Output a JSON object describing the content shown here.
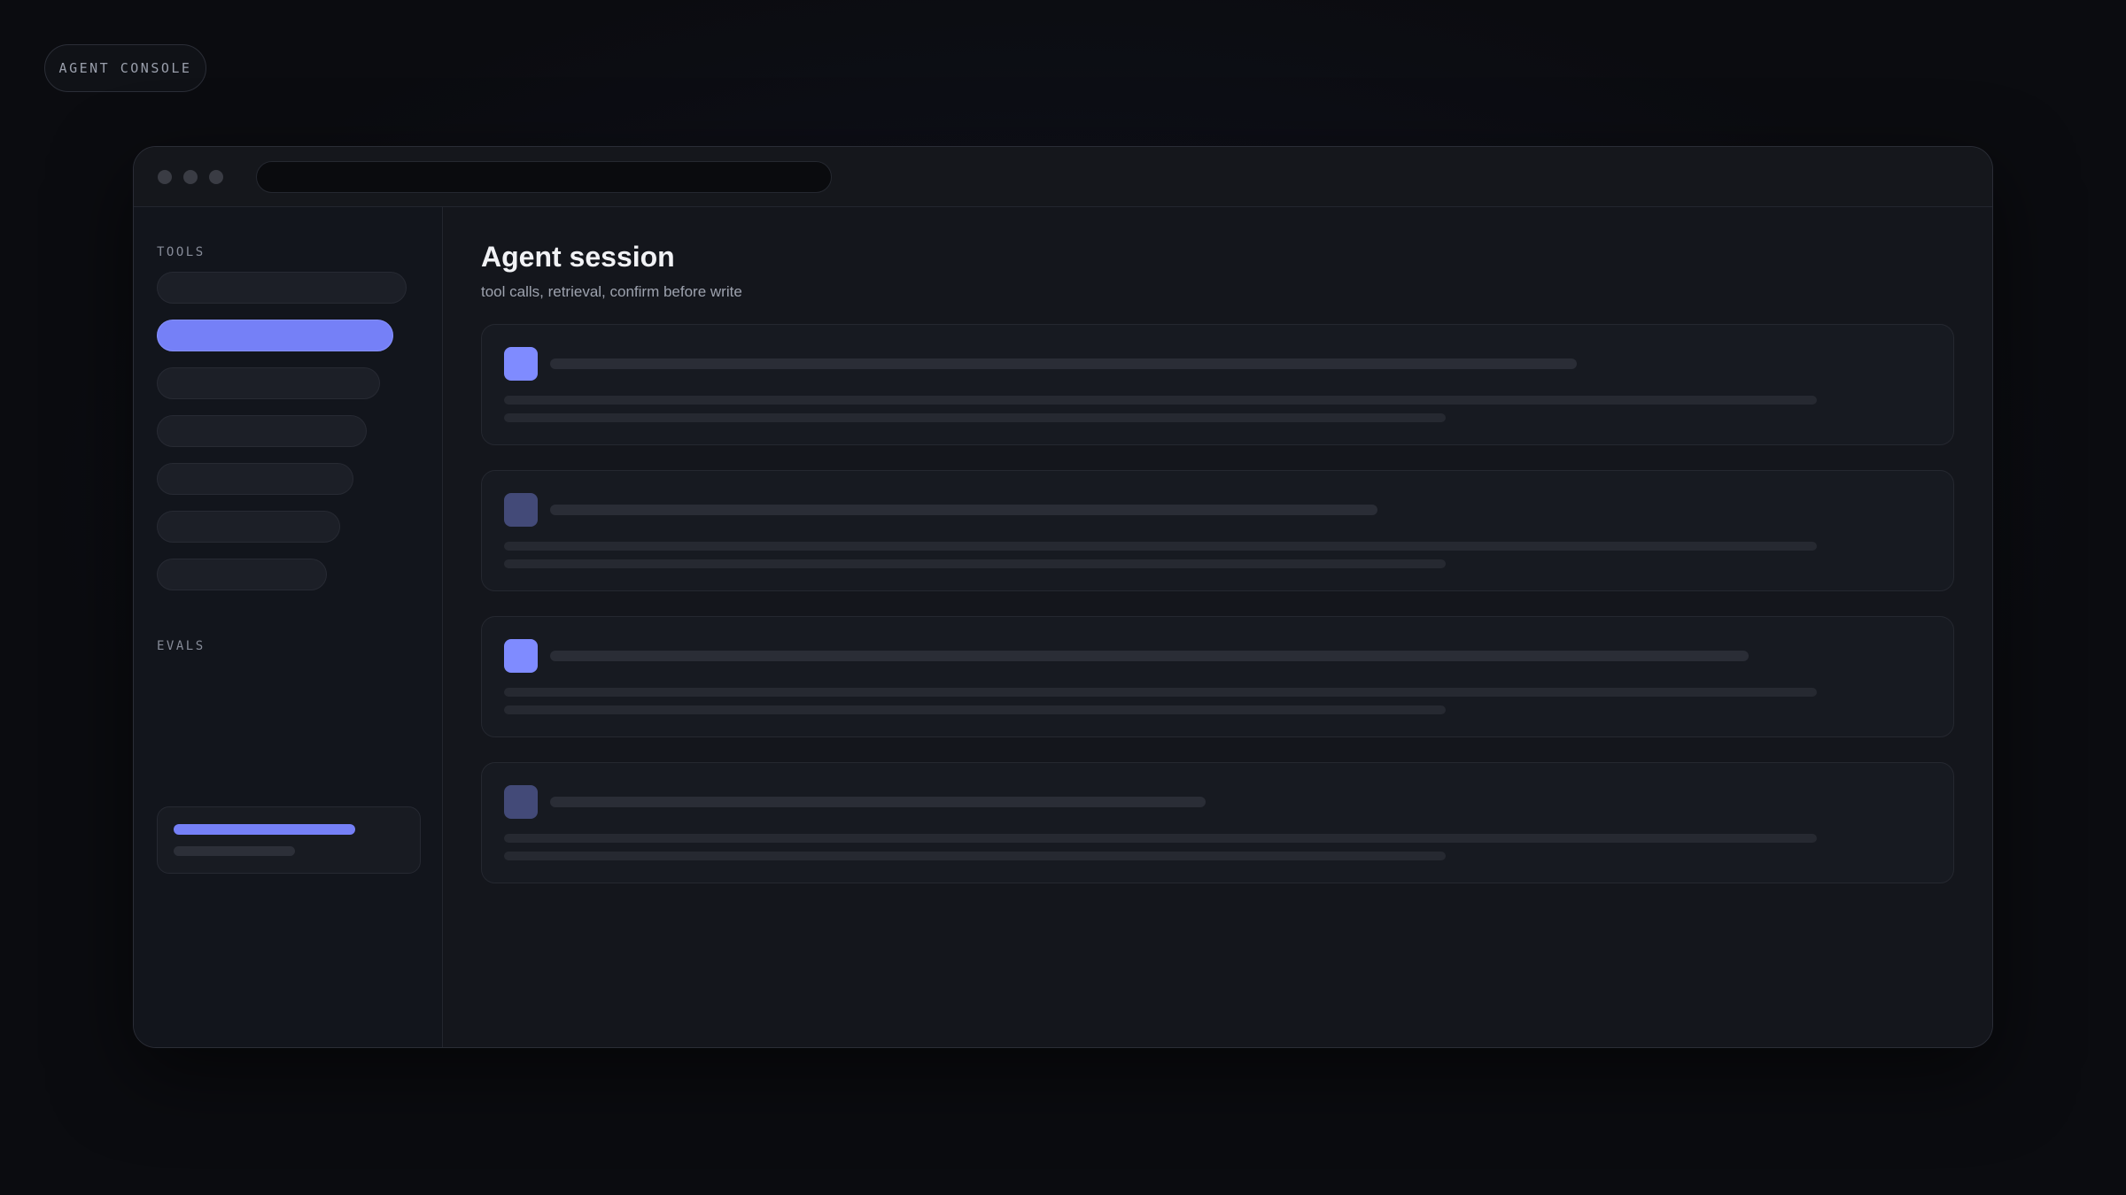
{
  "badge": {
    "label": "AGENT CONSOLE"
  },
  "window": {
    "sidebar": {
      "tools_label": "TOOLS",
      "evals_label": "EVALS",
      "tool_count": 7,
      "active_tool_index": 1,
      "eval_progress": 0.7
    },
    "main": {
      "title": "Agent session",
      "subtitle": "tool calls, retrieval, confirm before write",
      "cards": [
        {
          "icon_state": "active"
        },
        {
          "icon_state": "muted"
        },
        {
          "icon_state": "active"
        },
        {
          "icon_state": "muted"
        }
      ]
    }
  },
  "colors": {
    "accent": "#7580f7",
    "accent_muted": "#434a78",
    "background": "#0b0c10",
    "window": "#13151b"
  }
}
